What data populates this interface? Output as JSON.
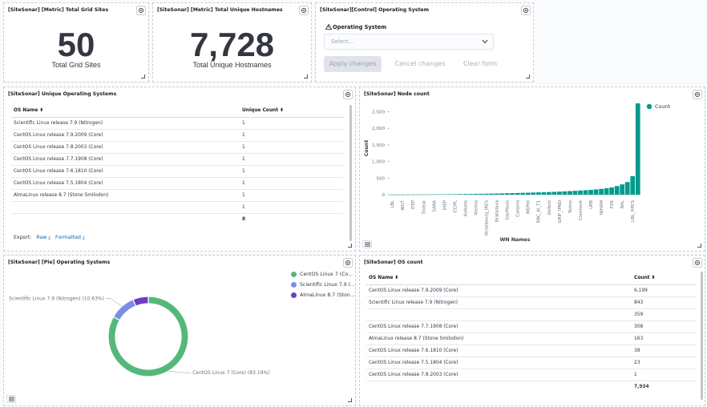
{
  "metric_sites": {
    "title": "[SiteSonar] [Metric] Total Grid Sites",
    "value": "50",
    "label": "Total Grid Sites"
  },
  "metric_hosts": {
    "title": "[SiteSonar] [Metric] Total Unique Hostnames",
    "value": "7,728",
    "label": "Total Unique Hostnames"
  },
  "control": {
    "title": "[SiteSonar][Control] Operating System",
    "field_label": "Operating System",
    "placeholder": "Select...",
    "apply_label": "Apply changes",
    "cancel_label": "Cancel changes",
    "clear_label": "Clear form"
  },
  "unique_os": {
    "title": "[SiteSonar] Unique Operating Systems",
    "col_name": "OS Name",
    "col_count": "Unique Count",
    "rows": [
      {
        "name": "Scientific Linux release 7.9 (Nitrogen)",
        "count": "1"
      },
      {
        "name": "CentOS Linux release 7.9.2009 (Core)",
        "count": "1"
      },
      {
        "name": "CentOS Linux release 7.8.2003 (Core)",
        "count": "1"
      },
      {
        "name": "CentOS Linux release 7.7.1908 (Core)",
        "count": "1"
      },
      {
        "name": "CentOS Linux release 7.6.1810 (Core)",
        "count": "1"
      },
      {
        "name": "CentOS Linux release 7.5.1804 (Core)",
        "count": "1"
      },
      {
        "name": "AlmaLinux release 8.7 (Stone Smilodon)",
        "count": "1"
      },
      {
        "name": "",
        "count": "1"
      }
    ],
    "total": "8",
    "export_label": "Export:",
    "raw_label": "Raw",
    "formatted_label": "Formatted"
  },
  "node_count": {
    "title": "[SiteSonar] Node count",
    "chart_data": {
      "type": "bar",
      "xlabel": "WN Names",
      "ylabel": "Count",
      "ylim": [
        0,
        2800
      ],
      "yticks": [
        0,
        500,
        1000,
        1500,
        2000,
        2500
      ],
      "ytick_labels": [
        "0",
        "500",
        "1,000",
        "1,500",
        "2,000",
        "2,500"
      ],
      "legend": "top-right",
      "series": [
        {
          "name": "Count",
          "color": "#009b8f"
        }
      ],
      "categories": [
        "LBL",
        "",
        "WUT",
        "",
        "ITEP",
        "",
        "Troitsk",
        "",
        "SARA",
        "",
        "IHEP",
        "",
        "CCIPL",
        "",
        "Kolkata",
        "",
        "Vienna",
        "",
        "Strasbourg_IRES",
        "",
        "Bratislava",
        "",
        "SaoPaulo",
        "",
        "Catania",
        "",
        "MEPHI",
        "",
        "RRC_KI_T1",
        "",
        "Oxford",
        "",
        "GRIF_IPNO",
        "",
        "Torino",
        "",
        "Clermont",
        "",
        "UPB",
        "",
        "NIHAM",
        "",
        "FZK",
        "",
        "RAL",
        "",
        "LBL_HPCS"
      ],
      "values": [
        2,
        3,
        3,
        4,
        5,
        6,
        7,
        8,
        9,
        10,
        12,
        13,
        15,
        18,
        20,
        22,
        25,
        28,
        30,
        33,
        36,
        40,
        44,
        48,
        52,
        56,
        60,
        65,
        70,
        75,
        80,
        86,
        92,
        100,
        108,
        116,
        125,
        135,
        145,
        160,
        175,
        195,
        220,
        260,
        310,
        380,
        560,
        2750
      ]
    }
  },
  "pie": {
    "title": "[SiteSonar] [Pie] Operating Systems",
    "chart_data": {
      "type": "pie",
      "legend": "top-right",
      "slices": [
        {
          "name": "CentOS Linux 7 (Co...",
          "value": 83.19,
          "color": "#54b87a",
          "label": "CentOS Linux 7 (Core) (83.19%)"
        },
        {
          "name": "Scientific Linux 7.9 (...",
          "value": 10.63,
          "color": "#7b8ee6",
          "label": "Scientific Linux 7.9 (Nitrogen) (10.63%)"
        },
        {
          "name": "AlmaLinux 8.7 (Ston...",
          "value": 6.18,
          "color": "#6e3ec5",
          "label": ""
        }
      ]
    }
  },
  "os_count": {
    "title": "[SiteSonar] OS count",
    "col_name": "OS Name",
    "col_count": "Count",
    "rows": [
      {
        "name": "CentOS Linux release 7.9.2009 (Core)",
        "count": "6,199"
      },
      {
        "name": "Scientific Linux release 7.9 (Nitrogen)",
        "count": "843"
      },
      {
        "name": "",
        "count": "359"
      },
      {
        "name": "CentOS Linux release 7.7.1908 (Core)",
        "count": "308"
      },
      {
        "name": "AlmaLinux release 8.7 (Stone Smilodon)",
        "count": "163"
      },
      {
        "name": "CentOS Linux release 7.6.1810 (Core)",
        "count": "38"
      },
      {
        "name": "CentOS Linux release 7.5.1804 (Core)",
        "count": "23"
      },
      {
        "name": "CentOS Linux release 7.8.2003 (Core)",
        "count": "1"
      }
    ],
    "total": "7,934"
  }
}
